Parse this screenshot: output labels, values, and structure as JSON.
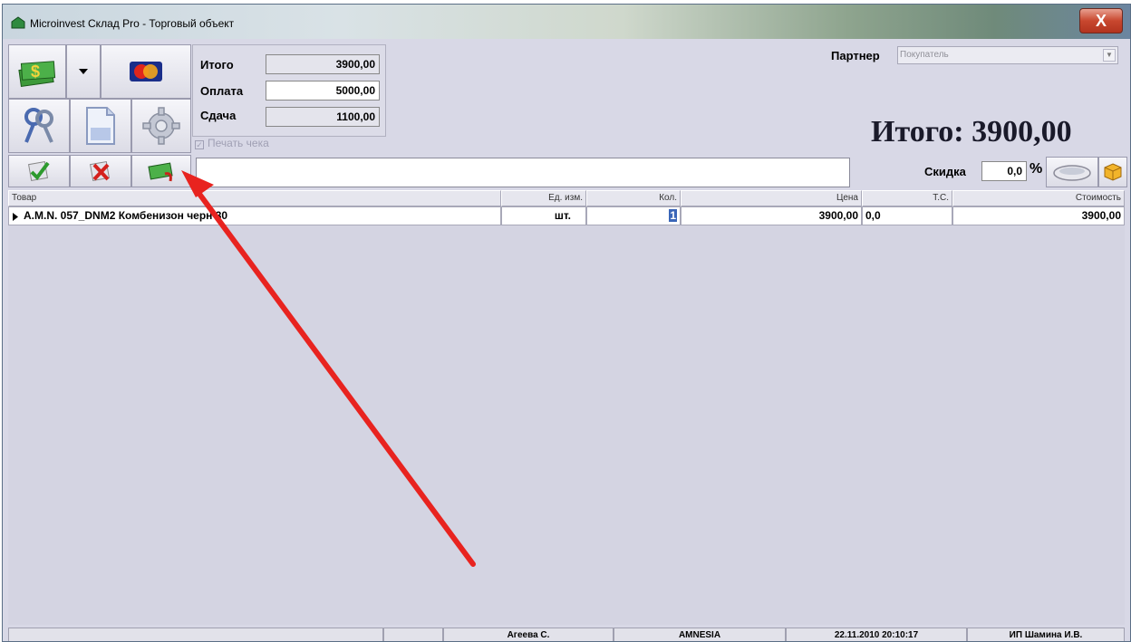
{
  "window": {
    "title": "Microinvest Склад Pro - Торговый объект",
    "close_label": "X"
  },
  "toolbar": {
    "icons": [
      "cash-payment-icon",
      "dropdown-arrow-icon",
      "card-payment-icon",
      "keys-icon",
      "document-icon",
      "settings-icon",
      "confirm-icon",
      "cancel-icon",
      "cash-return-icon"
    ]
  },
  "totals": {
    "total_label": "Итого",
    "total_value": "3900,00",
    "payment_label": "Оплата",
    "payment_value": "5000,00",
    "change_label": "Сдача",
    "change_value": "1100,00",
    "print_receipt_label": "Печать чека"
  },
  "partner": {
    "label": "Партнер",
    "value": "Покупатель"
  },
  "big_total": "Итого: 3900,00",
  "discount": {
    "label": "Скидка",
    "value": "0,0",
    "unit": "%"
  },
  "table": {
    "columns": [
      "Товар",
      "Ед. изм.",
      "Кол.",
      "Цена",
      "Т.С.",
      "Стоимость"
    ],
    "rows": [
      {
        "item": "A.M.N. 057_DNM2 Комбенизон черн 30",
        "unit": "шт.",
        "qty": "1",
        "price": "3900,00",
        "tc": "0,0",
        "cost": "3900,00"
      }
    ]
  },
  "status": {
    "operator": "Агеева С.",
    "object": "AMNESIA",
    "datetime": "22.11.2010 20:10:17",
    "company": "ИП Шамина И.В."
  },
  "colors": {
    "window_bg": "#d8d8e6",
    "annotation_arrow": "#e8231f",
    "selection": "#3a66b8"
  }
}
